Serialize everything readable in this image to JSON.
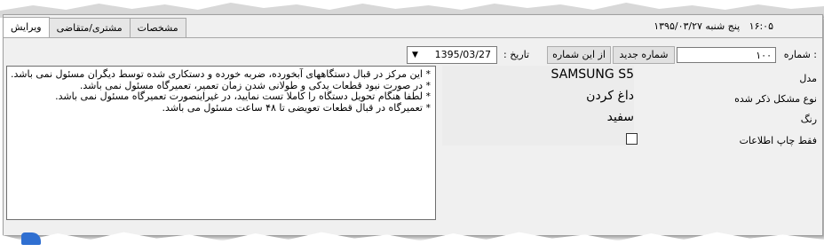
{
  "header": {
    "time": "۱۶:۰۵",
    "weekday": "پنج شنبه",
    "date": "۱۳۹۵/۰۳/۲۷"
  },
  "tabs": [
    {
      "label": "ویرایش",
      "active": true
    },
    {
      "label": "مشتری/متقاضی",
      "active": false
    },
    {
      "label": "مشخصات",
      "active": false
    }
  ],
  "form": {
    "number_label": "شماره :",
    "number_value": "۱۰۰",
    "new_number_button": "شماره جدید",
    "from_number_button": "از این شماره",
    "date_label": "تاریخ :",
    "date_value": "1395/03/27",
    "model_label": "مدل",
    "model_value": "SAMSUNG S5",
    "problem_label": "نوع مشکل ذکر شده",
    "problem_value": "داغ کردن",
    "color_label": "رنگ",
    "color_value": "سفید",
    "print_only_label": "فقط چاپ اطلاعات"
  },
  "notes": [
    "* این مرکز در قبال دستگاههای آبخورده، ضربه خورده و دستکاری شده توسط دیگران مسئول نمی باشد.",
    "* در صورت نبود قطعات یدکی و طولانی شدن زمان تعمیر، تعمیرگاه مسئول نمی باشد.",
    "* لطفا هنگام تحویل دستگاه را کاملا تست نمایید، در غیراینصورت تعمیرگاه مسئول نمی باشد.",
    "* تعمیرگاه در قبال قطعات تعویضی تا ۴۸ ساعت مسئول می باشد."
  ]
}
